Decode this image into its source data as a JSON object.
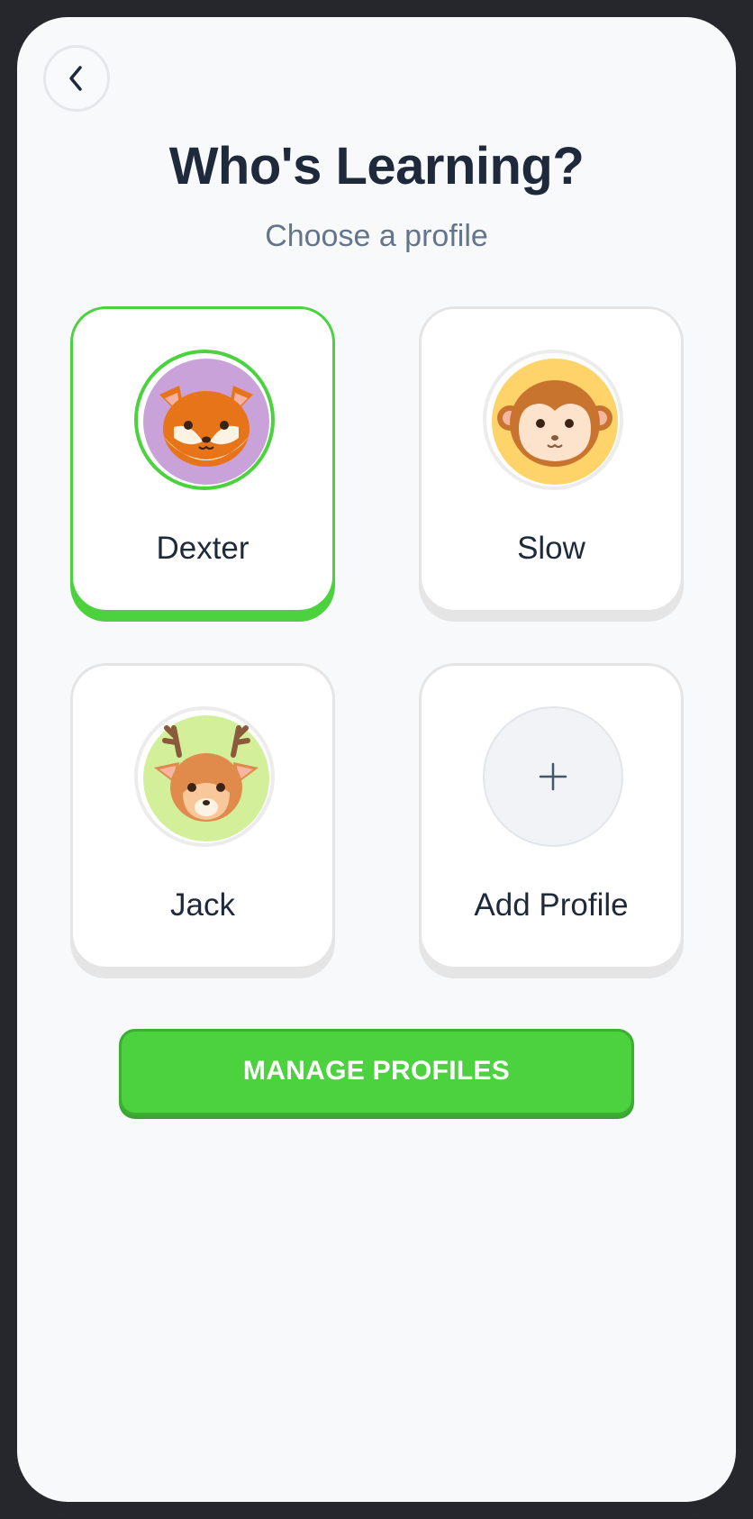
{
  "header": {
    "back_icon": "chevron-left-icon",
    "title": "Who's Learning?",
    "subtitle": "Choose a profile"
  },
  "profiles": [
    {
      "name": "Dexter",
      "avatar": "fox-avatar",
      "avatar_bg": "#c9a2d9",
      "selected": true
    },
    {
      "name": "Slow",
      "avatar": "monkey-avatar",
      "avatar_bg": "#fdd36a",
      "selected": false
    },
    {
      "name": "Jack",
      "avatar": "deer-avatar",
      "avatar_bg": "#d3ef9a",
      "selected": false
    }
  ],
  "add_profile": {
    "label": "Add Profile",
    "icon": "plus-icon"
  },
  "manage_button": {
    "label": "MANAGE PROFILES"
  },
  "colors": {
    "accent": "#4cd13f",
    "title": "#1e293b",
    "subtitle": "#64748b",
    "background": "#f8f9fb"
  }
}
